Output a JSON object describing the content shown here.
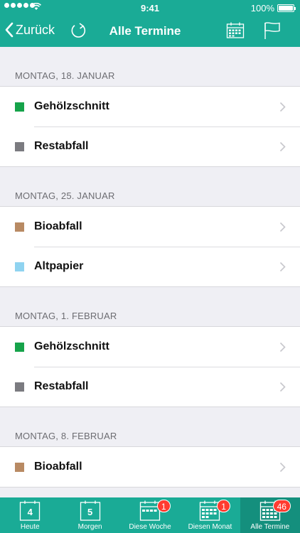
{
  "status_bar": {
    "time": "9:41",
    "battery": "100%"
  },
  "nav": {
    "back_label": "Zurück",
    "title": "Alle Termine"
  },
  "sections": [
    {
      "header": "MONTAG, 18. JANUAR",
      "items": [
        {
          "label": "Gehölzschnitt",
          "color": "#16a34a"
        },
        {
          "label": "Restabfall",
          "color": "#7b7b80"
        }
      ]
    },
    {
      "header": "MONTAG, 25. JANUAR",
      "items": [
        {
          "label": "Bioabfall",
          "color": "#b88a63"
        },
        {
          "label": "Altpapier",
          "color": "#8fd3f0"
        }
      ]
    },
    {
      "header": "MONTAG, 1. FEBRUAR",
      "items": [
        {
          "label": "Gehölzschnitt",
          "color": "#16a34a"
        },
        {
          "label": "Restabfall",
          "color": "#7b7b80"
        }
      ]
    },
    {
      "header": "MONTAG, 8. FEBRUAR",
      "items": [
        {
          "label": "Bioabfall",
          "color": "#b88a63"
        }
      ]
    }
  ],
  "tabs": [
    {
      "label": "Heute",
      "day": "4"
    },
    {
      "label": "Morgen",
      "day": "5"
    },
    {
      "label": "Diese Woche",
      "badge": "1"
    },
    {
      "label": "Diesen Monat",
      "badge": "1"
    },
    {
      "label": "Alle Termine",
      "badge": "46"
    }
  ],
  "colors": {
    "accent": "#1aab96",
    "badge": "#ff3b30"
  }
}
